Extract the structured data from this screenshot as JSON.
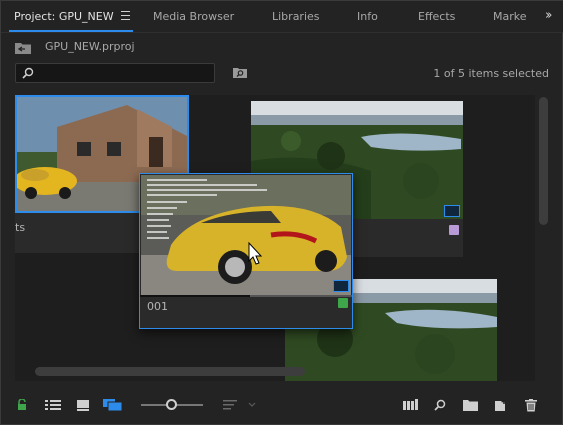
{
  "tabs": [
    {
      "label": "Project: GPU_NEW",
      "active": true
    },
    {
      "label": "Media Browser"
    },
    {
      "label": "Libraries"
    },
    {
      "label": "Info"
    },
    {
      "label": "Effects"
    },
    {
      "label": "Marke"
    }
  ],
  "project": {
    "file_name": "GPU_NEW.prproj"
  },
  "search": {
    "value": "",
    "placeholder": ""
  },
  "status": {
    "selection_text": "1 of 5 items selected"
  },
  "items": [
    {
      "name": "ts",
      "label_color": "#2d8ceb"
    },
    {
      "name": "",
      "label_color": "#b89ad6"
    },
    {
      "name": "001",
      "label_color": "#3fa54a"
    },
    {
      "name": "",
      "label_color": ""
    }
  ],
  "colors": {
    "accent": "#2d8ceb",
    "lock_green": "#3fa54a",
    "label_purple": "#b89ad6"
  },
  "bottom_icons": [
    "lock-icon",
    "list-view-icon",
    "icon-view-icon",
    "freeform-view-icon",
    "zoom-slider",
    "sort-icon",
    "automate-sequence-icon",
    "find-icon",
    "new-bin-icon",
    "new-item-icon",
    "trash-icon"
  ]
}
